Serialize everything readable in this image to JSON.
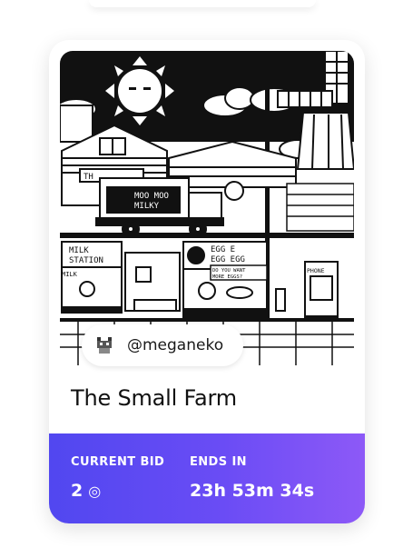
{
  "card": {
    "creator_handle": "@meganeko",
    "title": "The Small Farm",
    "current_bid_label": "CURRENT BID",
    "current_bid_value": "2",
    "currency_icon": "coin-icon",
    "ends_in_label": "ENDS IN",
    "ends_in_value": "23h 53m 34s"
  },
  "artwork": {
    "truck_text_1": "MOO MOO",
    "truck_text_2": "MILKY",
    "milk_station_1": "MILK",
    "milk_station_2": "STATION",
    "egg_sign_1": "EGG E",
    "egg_sign_2": "EGG EGG",
    "egg_bubble_1": "DO YOU WANT",
    "egg_bubble_2": "MORE EGGS?",
    "phone_label": "PHONE",
    "barn_label": "TH",
    "milk_small": "MILK"
  },
  "colors": {
    "footer_start": "#5147f0",
    "footer_end": "#8d59f7",
    "art_dark": "#111111"
  }
}
